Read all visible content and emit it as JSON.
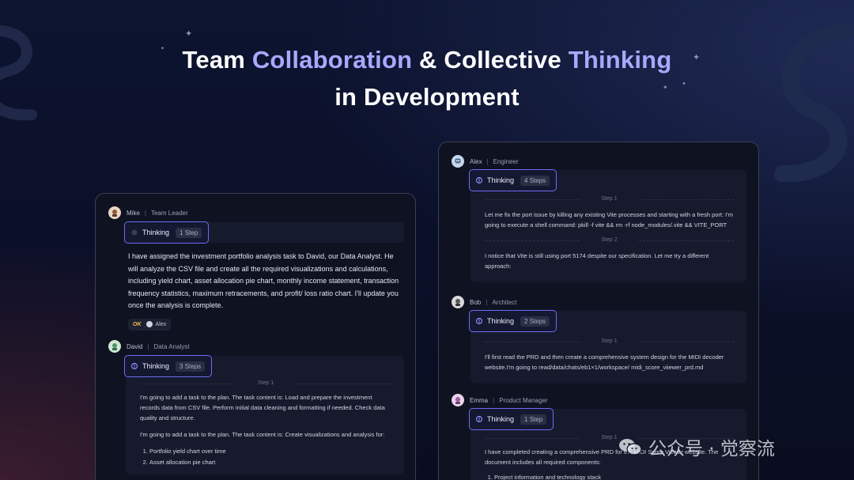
{
  "headline": {
    "line1_part1": "Team ",
    "line1_hl1": "Collaboration",
    "line1_part2": " & Collective ",
    "line1_hl2": "Thinking",
    "line2": "in Development"
  },
  "left_panel": {
    "messages": [
      {
        "name": "Mike",
        "role": "Team Leader",
        "avatar_icon": "mike-avatar-icon",
        "thinking_label": "Thinking",
        "steps": "1 Step",
        "text": "I have assigned the investment portfolio analysis task to David, our Data Analyst. He will analyze the CSV file and create all the required visualizations and calculations, including yield chart, asset allocation pie chart, monthly income statement, transaction frequency statistics, maximum retracements, and profit/ loss ratio chart. I'll update you once the analysis is complete.",
        "tag_ok": "OK",
        "tag_name": "Alex"
      },
      {
        "name": "David",
        "role": "Data Analyst",
        "avatar_icon": "david-avatar-icon",
        "thinking_label": "Thinking",
        "steps": "3 Steps",
        "step_label": "Step 1",
        "paragraphs": [
          "I'm going to add a task to the plan. The task content is: Load and prepare the investment records data from CSV file. Perform initial data cleaning and formatting if needed. Check data quality and structure.",
          "I'm going to add a task to the plan. The task content is: Create visualizations and analysis for:"
        ],
        "list": [
          "Portfolio yield chart over time",
          "Asset allocation pie chart"
        ]
      }
    ]
  },
  "right_panel": {
    "messages": [
      {
        "name": "Alex",
        "role": "Engineer",
        "avatar_icon": "alex-avatar-icon",
        "thinking_label": "Thinking",
        "steps": "4 Steps",
        "blocks": [
          {
            "step_label": "Step 1",
            "text": "Let me fix the port issue by killing any existing Vite processes and starting with a fresh port: I'm going to execute a shell command: pkill -f vite && rm -rf node_modules/.vite && VITE_PORT"
          },
          {
            "step_label": "Step 2",
            "text": "I notice that Vite is still using port 5174 despite our specification. Let me try a different approach:"
          }
        ]
      },
      {
        "name": "Bob",
        "role": "Architect",
        "avatar_icon": "bob-avatar-icon",
        "thinking_label": "Thinking",
        "steps": "2 Steps",
        "blocks": [
          {
            "step_label": "Step 1",
            "text": "I'll first read the PRD and then create a comprehensive system design for the MIDI decoder website.I'm going to read/data/chats/eb1×1/workspace/ midi_score_viiewer_prd.md"
          }
        ]
      },
      {
        "name": "Emma",
        "role": "Product Manager",
        "avatar_icon": "emma-avatar-icon",
        "thinking_label": "Thinking",
        "steps": "1 Step",
        "blocks": [
          {
            "step_label": "Step 1",
            "text": "I have completed creating a comprehensive PRD for the MIDI Score Viewer website. The document includes all required components:"
          }
        ],
        "list": [
          "Project information and technology stack"
        ]
      }
    ]
  },
  "watermark": {
    "text": "公众号 · 觉察流"
  },
  "colors": {
    "accent": "#a8a9ff",
    "pill_border": "#6f6cf5",
    "ok": "#f2c14a"
  }
}
